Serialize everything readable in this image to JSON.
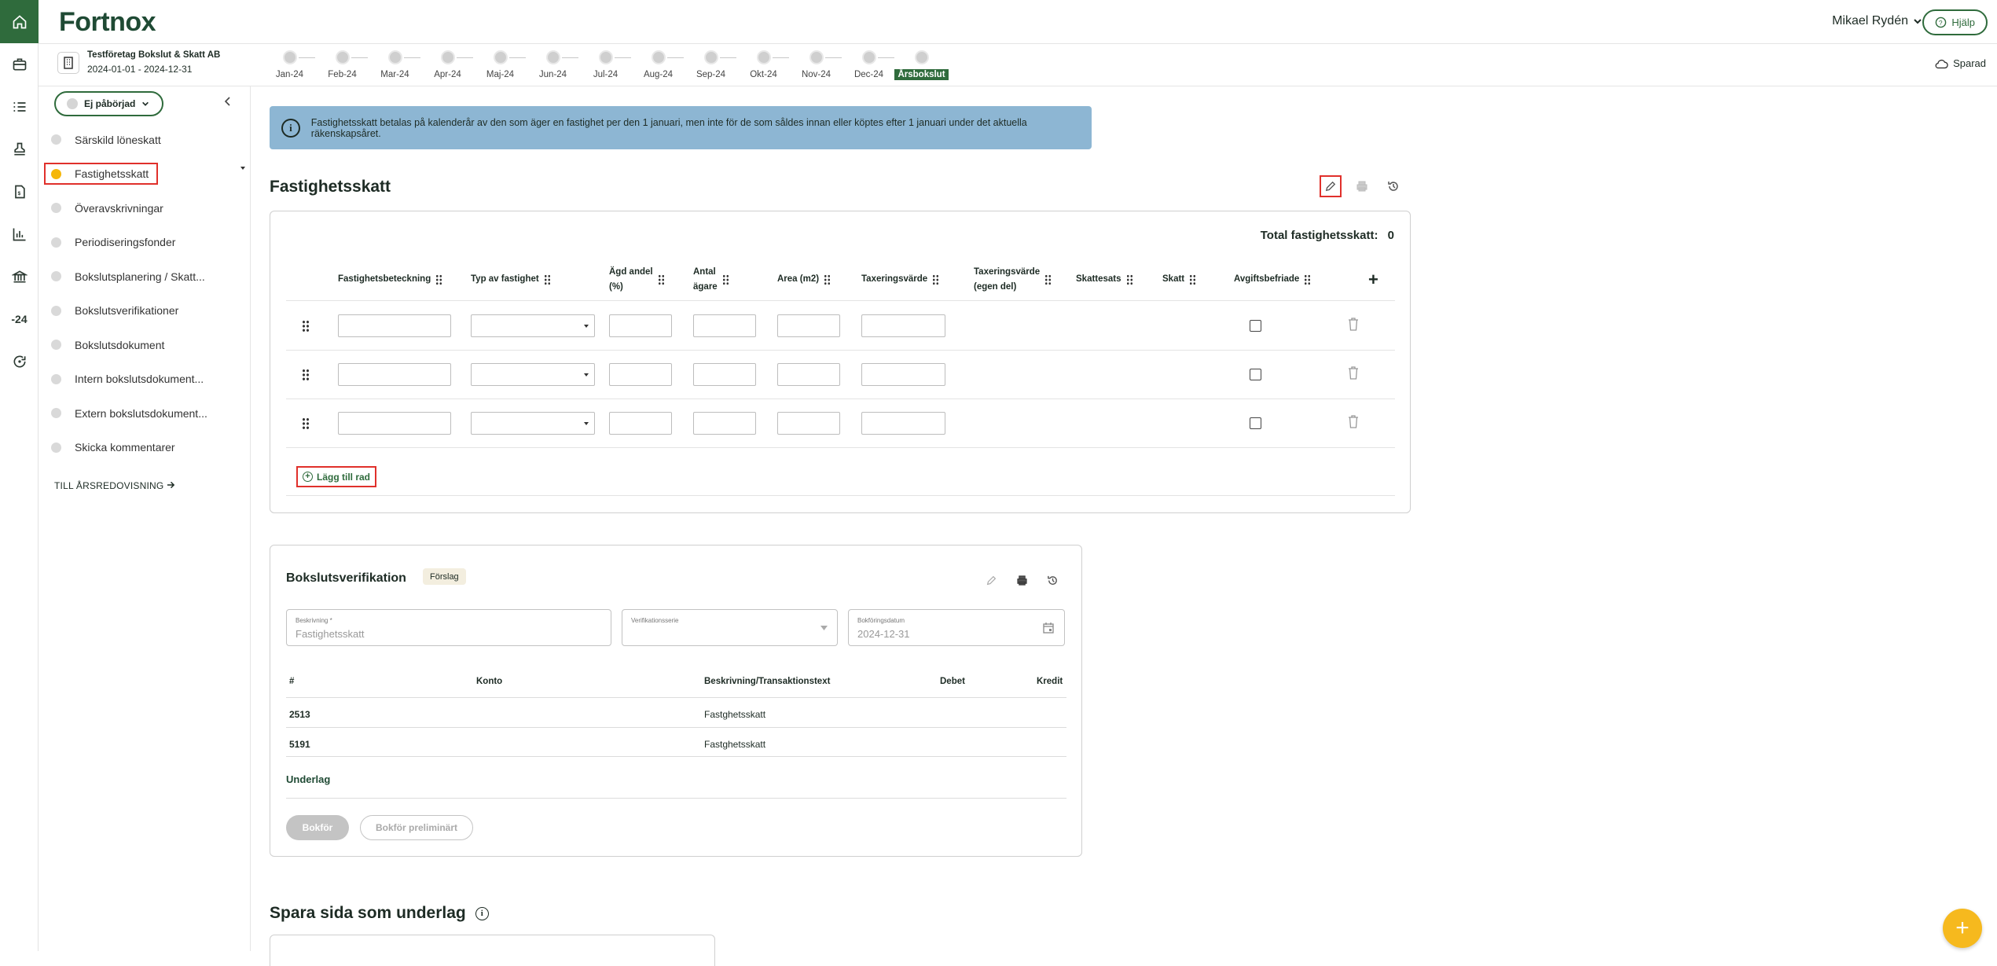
{
  "rail": {
    "items": [
      {
        "icon": "home-icon"
      },
      {
        "icon": "briefcase-icon"
      },
      {
        "icon": "checklist-icon"
      },
      {
        "icon": "stamp-icon"
      },
      {
        "icon": "document-icon"
      },
      {
        "icon": "chart-icon"
      },
      {
        "icon": "bank-icon"
      },
      {
        "text": "-24"
      },
      {
        "icon": "refresh-icon"
      }
    ]
  },
  "header": {
    "logo": "Fortnox",
    "user": "Mikael Rydén",
    "help": "Hjälp",
    "saved": "Sparad"
  },
  "company": {
    "name": "Testföretag Bokslut & Skatt AB",
    "period": "2024-01-01 - 2024-12-31"
  },
  "months": [
    "Jan-24",
    "Feb-24",
    "Mar-24",
    "Apr-24",
    "Maj-24",
    "Jun-24",
    "Jul-24",
    "Aug-24",
    "Sep-24",
    "Okt-24",
    "Nov-24",
    "Dec-24",
    "Årsbokslut"
  ],
  "sidebar": {
    "status": "Ej påbörjad",
    "items": [
      {
        "label": "Särskild löneskatt",
        "selected": false
      },
      {
        "label": "Fastighetsskatt",
        "selected": true
      },
      {
        "label": "Överavskrivningar",
        "selected": false
      },
      {
        "label": "Periodiseringsfonder",
        "selected": false
      },
      {
        "label": "Bokslutsplanering / Skatt...",
        "selected": false
      },
      {
        "label": "Bokslutsverifikationer",
        "selected": false
      },
      {
        "label": "Bokslutsdokument",
        "selected": false
      },
      {
        "label": "Intern bokslutsdokument...",
        "selected": false
      },
      {
        "label": "Extern bokslutsdokument...",
        "selected": false
      },
      {
        "label": "Skicka kommentarer",
        "selected": false
      }
    ],
    "footer_link": "TILL ÅRSREDOVISNING"
  },
  "info": {
    "text": "Fastighetsskatt betalas på kalenderår av den som äger en fastighet per den 1 januari, men inte för de som såldes innan eller köptes efter 1 januari under det aktuella räkenskapsåret."
  },
  "section1": {
    "title": "Fastighetsskatt",
    "total_label": "Total fastighetsskatt:",
    "total_value": "0",
    "columns": [
      {
        "l1": "Fastighetsbeteckning"
      },
      {
        "l1": "Typ av fastighet"
      },
      {
        "l1": "Ägd andel",
        "l2": "(%)"
      },
      {
        "l1": "Antal",
        "l2": "ägare"
      },
      {
        "l1": "Area (m2)"
      },
      {
        "l1": "Taxeringsvärde"
      },
      {
        "l1": "Taxeringsvärde",
        "l2": "(egen del)"
      },
      {
        "l1": "Skattesats"
      },
      {
        "l1": "Skatt"
      },
      {
        "l1": "Avgiftsbefriade"
      }
    ],
    "row_count": 3,
    "add_row": "Lägg till rad"
  },
  "section2": {
    "title": "Bokslutsverifikation",
    "badge": "Förslag",
    "fields": {
      "description_label": "Beskrivning *",
      "description_value": "Fastighetsskatt",
      "series_label": "Verifikationsserie",
      "date_label": "Bokföringsdatum",
      "date_value": "2024-12-31"
    },
    "columns": {
      "num": "#",
      "account": "Konto",
      "text": "Beskrivning/Transaktionstext",
      "debet": "Debet",
      "kredit": "Kredit"
    },
    "rows": [
      {
        "num": "2513",
        "text": "Fastghetsskatt"
      },
      {
        "num": "5191",
        "text": "Fastghetsskatt"
      }
    ],
    "underlag": "Underlag",
    "book": "Bokför",
    "book_prelim": "Bokför preliminärt"
  },
  "section3": {
    "title": "Spara sida som underlag"
  },
  "colors": {
    "brand": "#2f6b3c",
    "highlight": "#e0302b",
    "info_bg": "#8db6d3",
    "status_pending": "#f5b70b",
    "fab": "#f6b91e"
  }
}
